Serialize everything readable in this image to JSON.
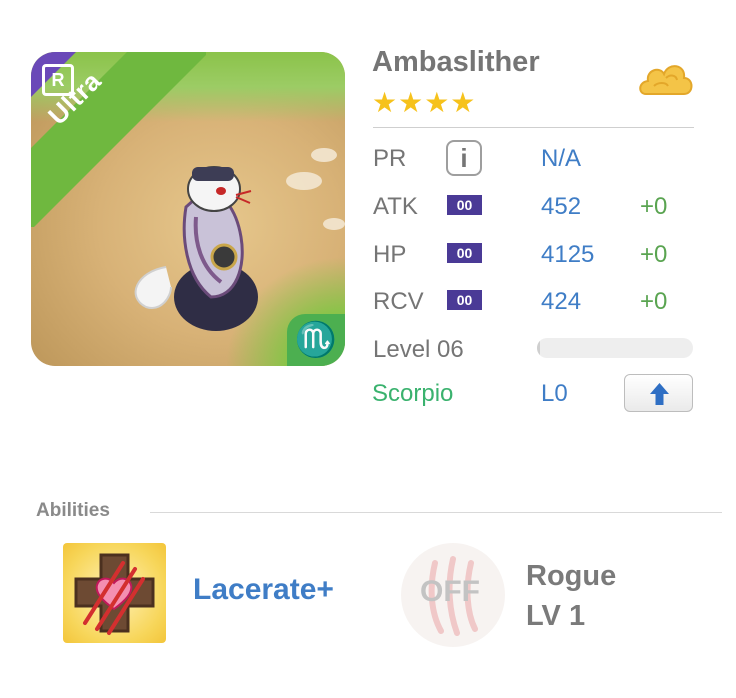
{
  "monster": {
    "name": "Ambaslither",
    "stars": "★★★★",
    "rarity_badge": "R",
    "rarity_label": "Ultra",
    "sign_glyph": "♏",
    "element_icon": "cloud-icon"
  },
  "stats": {
    "pr_label": "PR",
    "pr_value": "N/A",
    "info_glyph": "i",
    "atk_label": "ATK",
    "atk_plus": "00",
    "atk_value": "452",
    "atk_bonus": "+0",
    "hp_label": "HP",
    "hp_plus": "00",
    "hp_value": "4125",
    "hp_bonus": "+0",
    "rcv_label": "RCV",
    "rcv_plus": "00",
    "rcv_value": "424",
    "rcv_bonus": "+0",
    "level_label": "Level 06",
    "level_progress": 0.02,
    "zodiac": "Scorpio",
    "skill_level": "L0",
    "upgrade_icon": "arrow-up-icon"
  },
  "abilities": {
    "title": "Abilities",
    "active_name": "Lacerate+",
    "passive_state": "OFF",
    "passive_name": "Rogue",
    "passive_level": "LV 1"
  },
  "colors": {
    "accent_blue": "#3f7dc6",
    "bonus_green": "#5aa451",
    "zodiac_green": "#3ab26e",
    "star_gold": "#f6c21c",
    "badge_purple": "#4a3a96",
    "ribbon_green": "#6fb83f",
    "corner_purple": "#6a49b8"
  }
}
